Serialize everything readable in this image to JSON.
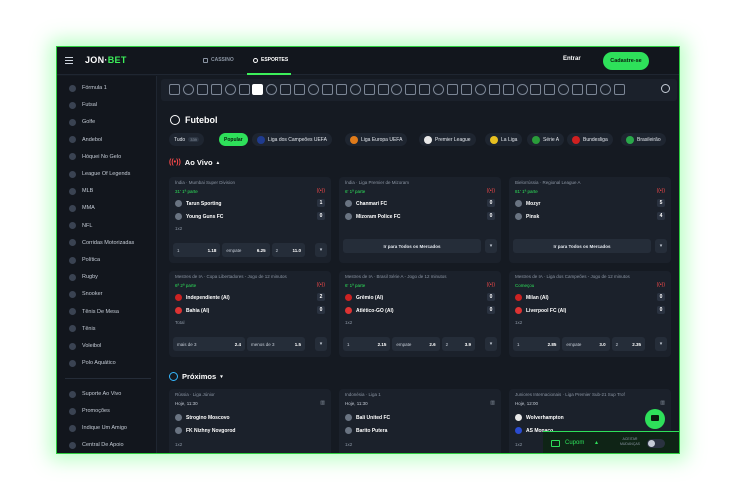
{
  "header": {
    "logo_main": "JON",
    "logo_accent": "BET",
    "tabs": [
      "CASSINO",
      "ESPORTES"
    ],
    "login": "Entrar",
    "signup": "Cadastre-se"
  },
  "sidebar": {
    "items": [
      "Fórmula 1",
      "Futsal",
      "Golfe",
      "Andebol",
      "Hóquei No Gelo",
      "League Of Legends",
      "MLB",
      "MMA",
      "NFL",
      "Corridas Motorizadas",
      "Política",
      "Rugby",
      "Snooker",
      "Tênis De Mesa",
      "Tênis",
      "Voleibol",
      "Polo Aquático"
    ],
    "footer": [
      "Suporte Ao Vivo",
      "Promoções",
      "Indique Um Amigo",
      "Central De Apoio"
    ]
  },
  "main": {
    "title": "Futebol",
    "filters": [
      {
        "label": "Tudo",
        "count": "339"
      },
      {
        "label": "Popular"
      },
      {
        "label": "Liga dos Campeões UEFA",
        "color": "#1f3b8f"
      },
      {
        "label": "Liga Europa UEFA",
        "color": "#e07b1a"
      },
      {
        "label": "Premier League",
        "color": "#e8e8e8"
      },
      {
        "label": "La Liga",
        "color": "#e8c020"
      },
      {
        "label": "Série A",
        "color": "#2a9d3a"
      },
      {
        "label": "Bundesliga",
        "color": "#d02020"
      },
      {
        "label": "Brasileirão",
        "color": "#2aa84a"
      }
    ],
    "live_title": "Ao Vivo",
    "next_title": "Próximos"
  },
  "live_cards": [
    {
      "league": "Índia · Mumbai Super Division",
      "time": "31' 1ª parte",
      "home": "Tarun Sporting",
      "away": "Young Guns FC",
      "hs": "1",
      "as": "0",
      "sub": "1x2",
      "odds": [
        [
          "1",
          "1.18"
        ],
        [
          "empate",
          "6.25"
        ],
        [
          "2",
          "11.0"
        ]
      ]
    },
    {
      "league": "Índia · Liga Premier de Mizoram",
      "time": "6' 1ª parte",
      "home": "Chanmari FC",
      "away": "Mizoram Police FC",
      "hs": "0",
      "as": "0",
      "market": "Ir para Todos os Mercados"
    },
    {
      "league": "Bielorrússia · Regional League A",
      "time": "81' 1ª parte",
      "home": "Mozyr",
      "away": "Pinsk",
      "hs": "5",
      "as": "4",
      "market": "Ir para Todos os Mercados"
    },
    {
      "league": "Mestres de IA · Copa Libertadores - Jogo de 12 minutos",
      "time": "6ª 2ª parte",
      "home": "Independiente (AI)",
      "away": "Bahia (AI)",
      "hs": "2",
      "as": "0",
      "sub": "Total",
      "odds": [
        [
          "mais de 3",
          "2.4"
        ],
        [
          "menos de 3",
          "1.5"
        ]
      ]
    },
    {
      "league": "Mestres de IA · Brasil Série A - Jogo de 12 minutos",
      "time": "6' 1ª parte",
      "home": "Grêmio (AI)",
      "away": "Atlético-GO (AI)",
      "hs": "0",
      "as": "0",
      "sub": "1x2",
      "odds": [
        [
          "1",
          "2.15"
        ],
        [
          "empate",
          "2.6"
        ],
        [
          "2",
          "3.9"
        ]
      ]
    },
    {
      "league": "Mestres de IA · Liga dos Campeões - Jogo de 12 minutos",
      "time": "Começou",
      "home": "Milan (AI)",
      "away": "Liverpool FC (AI)",
      "hs": "0",
      "as": "0",
      "sub": "1x2",
      "odds": [
        [
          "1",
          "2.85"
        ],
        [
          "empate",
          "3.0"
        ],
        [
          "2",
          "2.35"
        ]
      ]
    }
  ],
  "next_cards": [
    {
      "league": "Rússia · Liga Júnior",
      "time": "Hoje, 11:30",
      "home": "Strogino Moscovo",
      "away": "FK Nizhny Novgorod",
      "sub": "1x2"
    },
    {
      "league": "Indonésia · Liga 1",
      "time": "Hoje, 11:30",
      "home": "Bali United FC",
      "away": "Barito Putera",
      "sub": "1x2"
    },
    {
      "league": "Juniores Internacionais · Liga Premier Sub-21 Sup Trof",
      "time": "Hoje, 12:00",
      "home": "Wolverhampton",
      "away": "AS Monaco",
      "sub": "1x2"
    }
  ],
  "footer_bar": {
    "coupon": "Cupom",
    "accept": "ACEITAR MUDANÇAS"
  }
}
